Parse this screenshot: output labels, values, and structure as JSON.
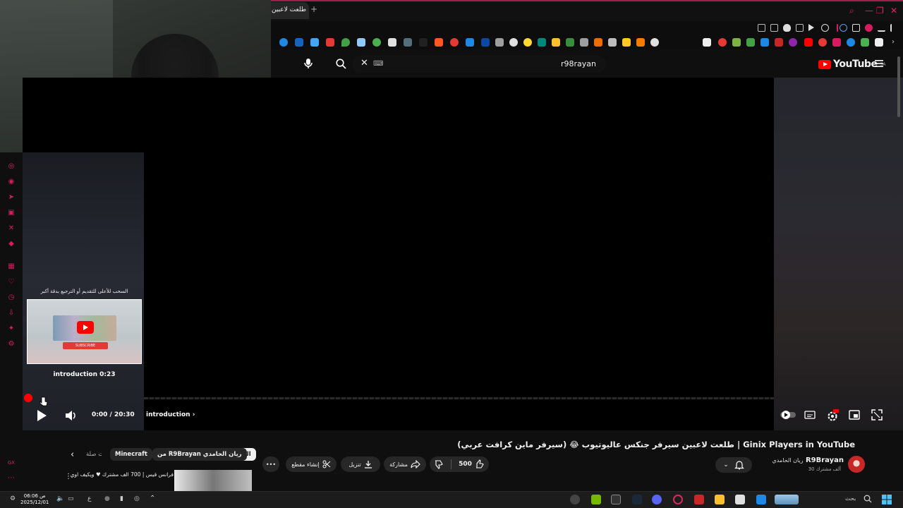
{
  "browser": {
    "active_tab_title": "طلعت لاعبين سيرفر",
    "new_tab_label": "+",
    "window_controls": [
      "search",
      "minimize",
      "restore",
      "close"
    ]
  },
  "youtube": {
    "logo_text": "YouTube",
    "country_code": "SA",
    "search_query": "r98rayan",
    "search_clear_label": "✕",
    "keyboard_label": "⌨"
  },
  "player": {
    "preview_hint": "السحب للأعلى للتقديم أو الترجيع بدقة أكبر",
    "preview_caption": "introduction  0:23",
    "current_time": "0:00 / 20:30",
    "chapter": "introduction",
    "progress": 0.0,
    "settings_badge": "HD",
    "preview_subscribe": "SUBSCRIBE"
  },
  "video": {
    "title": "طلعت لاعبين سيرفر جنكس عاليوتيوب 😂 (سيرفر ماين كرافت عربي) | Ginix Players in YouTube",
    "channel_name": "R9Brayan",
    "channel_name_ar": "ريان الحامدي",
    "subscribers": "30 ألف مشترك",
    "like_count": "500",
    "share_label": "مشاركة",
    "download_label": "تنزيل",
    "clip_label": "إنشاء مقطع",
    "more_label": "•••"
  },
  "chips": {
    "all": "الكل",
    "from_channel": "من R9Brayan ريان الحامدي",
    "minecraft": "Minecraft",
    "related": "ذات صلة"
  },
  "recommendation": {
    "title": "فرانس قيس | 700 الف مشترك ♥ ويكيف اوي"
  },
  "taskbar": {
    "time": "06:06 ص",
    "date": "2025/12/01",
    "search_label": "بحث",
    "lang": "ع"
  }
}
